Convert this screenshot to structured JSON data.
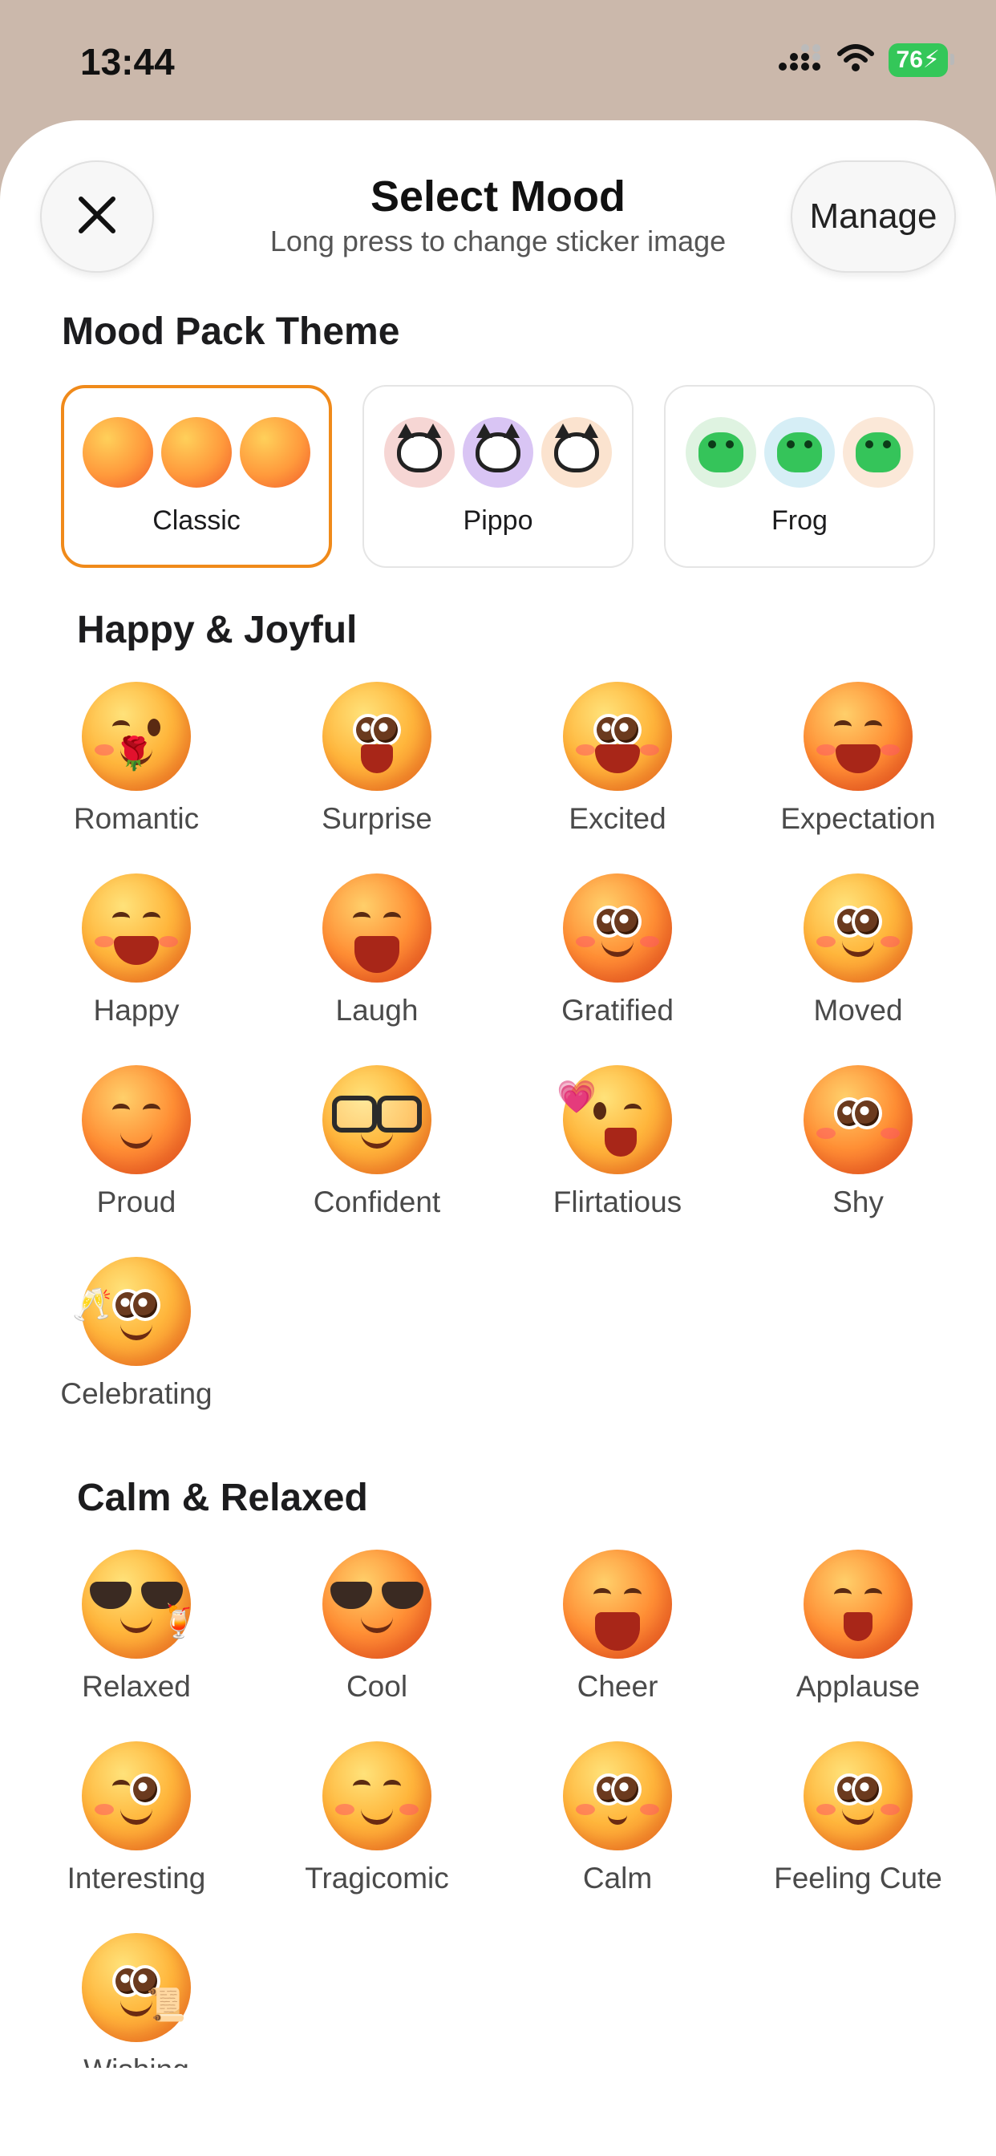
{
  "status_bar": {
    "time": "13:44",
    "battery": "76"
  },
  "header": {
    "title": "Select Mood",
    "subtitle": "Long press to change sticker image",
    "manage_label": "Manage"
  },
  "mood_pack": {
    "title": "Mood Pack Theme",
    "packs": [
      {
        "label": "Classic",
        "selected": true
      },
      {
        "label": "Pippo",
        "selected": false
      },
      {
        "label": "Frog",
        "selected": false
      }
    ]
  },
  "sections": [
    {
      "title": "Happy & Joyful",
      "moods": [
        "Romantic",
        "Surprise",
        "Excited",
        "Expectation",
        "Happy",
        "Laugh",
        "Gratified",
        "Moved",
        "Proud",
        "Confident",
        "Flirtatious",
        "Shy",
        "Celebrating"
      ]
    },
    {
      "title": "Calm & Relaxed",
      "moods": [
        "Relaxed",
        "Cool",
        "Cheer",
        "Applause",
        "Interesting",
        "Tragicomic",
        "Calm",
        "Feeling Cute",
        "Wishing"
      ]
    }
  ],
  "colors": {
    "accent": "#f08a1a",
    "battery": "#34c759",
    "background": "#cbb8ab"
  },
  "icons": {
    "close": "close-icon",
    "signal": "signal-icon",
    "wifi": "wifi-icon",
    "battery": "battery-icon"
  }
}
